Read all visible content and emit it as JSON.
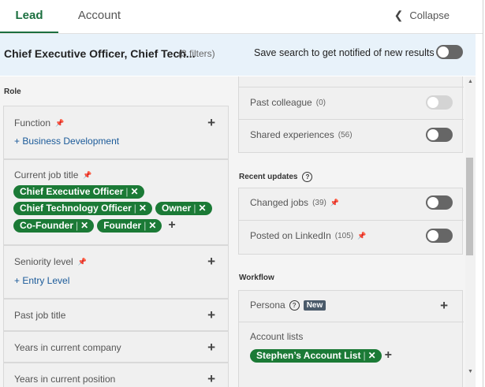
{
  "tabs": {
    "lead": "Lead",
    "account": "Account",
    "collapse": "Collapse"
  },
  "banner": {
    "title": "Chief Executive Officer, Chief Tech...",
    "count": "(3 filters)",
    "save_text": "Save search to get notified of new results",
    "toggle_on": false
  },
  "left": {
    "role_label": "Role",
    "function": {
      "label": "Function",
      "add_link": "+ Business Development"
    },
    "current_job_title": {
      "label": "Current job title",
      "chips": [
        "Chief Executive Officer",
        "Chief Technology Officer",
        "Owner",
        "Co-Founder",
        "Founder"
      ]
    },
    "seniority": {
      "label": "Seniority level",
      "add_link": "+ Entry Level"
    },
    "past_job_title": {
      "label": "Past job title"
    },
    "years_company": {
      "label": "Years in current company"
    },
    "years_position": {
      "label": "Years in current position"
    }
  },
  "right": {
    "past_colleague": {
      "label": "Past colleague",
      "count": "(0)"
    },
    "shared_experiences": {
      "label": "Shared experiences",
      "count": "(56)"
    },
    "recent_updates_label": "Recent updates",
    "changed_jobs": {
      "label": "Changed jobs",
      "count": "(39)"
    },
    "posted_linkedin": {
      "label": "Posted on LinkedIn",
      "count": "(105)"
    },
    "workflow_label": "Workflow",
    "persona": {
      "label": "Persona",
      "badge": "New"
    },
    "account_lists": {
      "label": "Account lists",
      "chip": "Stephen’s Account List"
    }
  },
  "icons": {
    "pin": "pin-icon",
    "plus": "plus-icon",
    "remove": "x-icon",
    "help": "question-circle-icon",
    "collapse": "chevron-left-icon"
  },
  "colors": {
    "accent": "#1b7a36",
    "link": "#1a5a99",
    "banner_bg": "#e8f2fa"
  }
}
